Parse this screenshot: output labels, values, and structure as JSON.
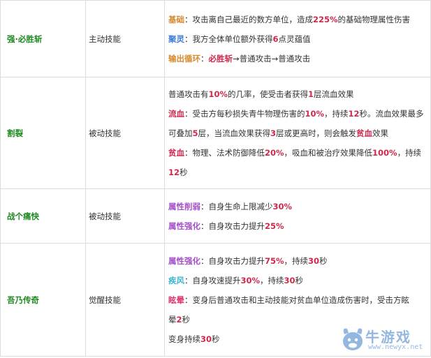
{
  "rows": [
    {
      "name": "强·必胜斩",
      "type": "主动技能",
      "lines": [
        [
          {
            "t": "基础",
            "c": "kw kw-orange"
          },
          {
            "t": "：攻击离自己最近的数方单位，造成"
          },
          {
            "t": "225%",
            "c": "num"
          },
          {
            "t": "的基础物理属性伤害"
          }
        ],
        [
          {
            "t": "聚灵",
            "c": "kw kw-blue"
          },
          {
            "t": "：我方全体单位额外获得"
          },
          {
            "t": "6",
            "c": "num"
          },
          {
            "t": "点灵蕴值"
          }
        ],
        [
          {
            "t": "输出循环",
            "c": "kw kw-orange"
          },
          {
            "t": "："
          },
          {
            "t": "必胜斩",
            "c": "kw kw-red"
          },
          {
            "t": "→普通攻击→普通攻击"
          }
        ]
      ]
    },
    {
      "name": "割裂",
      "type": "被动技能",
      "lines": [
        [
          {
            "t": "普通攻击有"
          },
          {
            "t": "10%",
            "c": "num"
          },
          {
            "t": "的几率，使受击者获得"
          },
          {
            "t": "1",
            "c": "num"
          },
          {
            "t": "层流血效果"
          }
        ],
        [
          {
            "t": "流血",
            "c": "kw kw-red"
          },
          {
            "t": "：受击方每秒损失青牛物理伤害的"
          },
          {
            "t": "10%",
            "c": "num"
          },
          {
            "t": "，持续"
          },
          {
            "t": "12",
            "c": "num"
          },
          {
            "t": "秒。流血效果最多"
          }
        ],
        [
          {
            "t": "可叠加"
          },
          {
            "t": "5",
            "c": "num"
          },
          {
            "t": "层，当流血效果获得"
          },
          {
            "t": "3",
            "c": "num"
          },
          {
            "t": "层或更高时，则会触发"
          },
          {
            "t": "贫血",
            "c": "kw kw-red"
          },
          {
            "t": "效果"
          }
        ],
        [
          {
            "t": "贫血",
            "c": "kw kw-red"
          },
          {
            "t": "：物理、法术防御降低"
          },
          {
            "t": "20%",
            "c": "num"
          },
          {
            "t": "，吸血和被治疗效果降低"
          },
          {
            "t": "100%",
            "c": "num"
          },
          {
            "t": "，持续"
          }
        ],
        [
          {
            "t": "12",
            "c": "num"
          },
          {
            "t": "秒"
          }
        ]
      ]
    },
    {
      "name": "战个痛快",
      "type": "被动技能",
      "lines": [
        [
          {
            "t": "属性削弱",
            "c": "kw kw-purple"
          },
          {
            "t": "：自身生命上限减少"
          },
          {
            "t": "30%",
            "c": "num"
          }
        ],
        [
          {
            "t": "属性强化",
            "c": "kw kw-purple"
          },
          {
            "t": "：自身攻击力提升"
          },
          {
            "t": "25%",
            "c": "num"
          }
        ]
      ]
    },
    {
      "name": "吾乃传奇",
      "type": "觉醒技能",
      "lines": [
        [
          {
            "t": "属性强化",
            "c": "kw kw-purple"
          },
          {
            "t": "：自身攻击力提升"
          },
          {
            "t": "75%",
            "c": "num"
          },
          {
            "t": "，持续"
          },
          {
            "t": "30",
            "c": "num"
          },
          {
            "t": "秒"
          }
        ],
        [
          {
            "t": "疾风",
            "c": "kw kw-cyan"
          },
          {
            "t": "：自身攻速提升"
          },
          {
            "t": "30%",
            "c": "num"
          },
          {
            "t": "，持续"
          },
          {
            "t": "30",
            "c": "num"
          },
          {
            "t": "秒"
          }
        ],
        [
          {
            "t": "眩晕",
            "c": "kw kw-pink"
          },
          {
            "t": "：变身后普通攻击和主动技能对贫血单位造成伤害时，受击方眩"
          }
        ],
        [
          {
            "t": "晕"
          },
          {
            "t": "2",
            "c": "num"
          },
          {
            "t": "秒"
          }
        ],
        [
          {
            "t": "变身持续"
          },
          {
            "t": "30",
            "c": "num"
          },
          {
            "t": "秒"
          }
        ]
      ]
    }
  ],
  "watermark": {
    "text": "牛游戏",
    "url": "www.newyx.net"
  }
}
